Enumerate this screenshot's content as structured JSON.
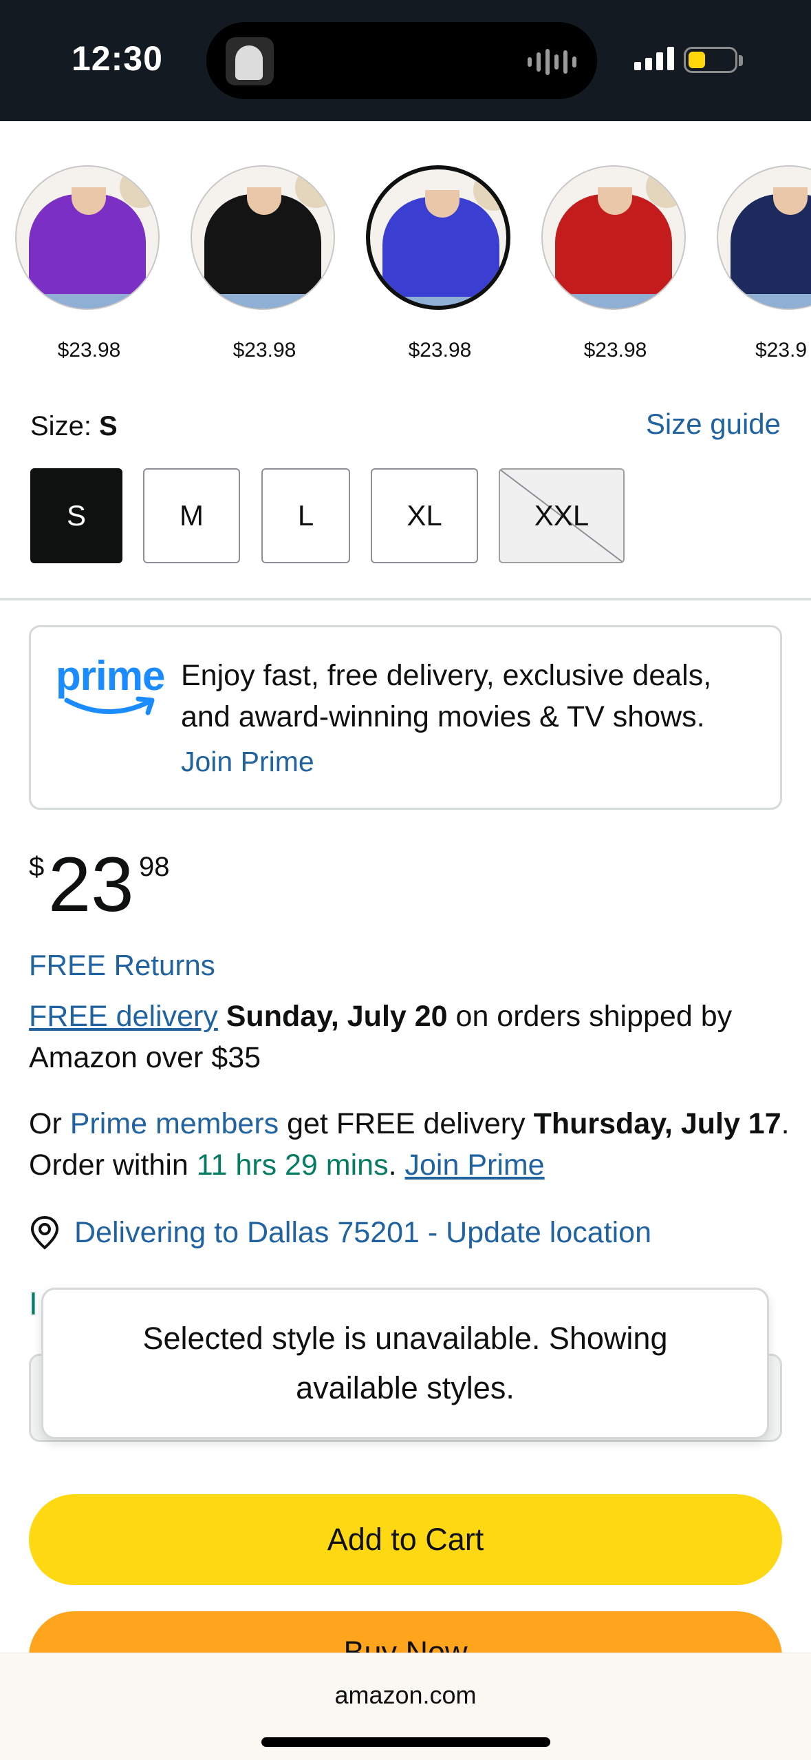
{
  "status_bar": {
    "time": "12:30"
  },
  "swatches": [
    {
      "color": "#7b2fc4",
      "price": "$23.98",
      "selected": false,
      "icon": "purple-shirt"
    },
    {
      "color": "#141414",
      "price": "$23.98",
      "selected": false,
      "icon": "black-shirt"
    },
    {
      "color": "#3b3fd1",
      "price": "$23.98",
      "selected": true,
      "icon": "blue-shirt"
    },
    {
      "color": "#c41c1c",
      "price": "$23.98",
      "selected": false,
      "icon": "red-shirt"
    },
    {
      "color": "#1c2a5e",
      "price": "$23.9",
      "selected": false,
      "icon": "navy-shirt"
    }
  ],
  "size": {
    "label": "Size: ",
    "value": "S",
    "guide_link": "Size guide",
    "options": [
      {
        "label": "S",
        "state": "selected"
      },
      {
        "label": "M",
        "state": "available"
      },
      {
        "label": "L",
        "state": "available"
      },
      {
        "label": "XL",
        "state": "available"
      },
      {
        "label": "XXL",
        "state": "unavailable"
      }
    ]
  },
  "prime_promo": {
    "logo_text": "prime",
    "text": "Enjoy fast, free delivery, exclusive deals, and award-winning movies & TV shows.",
    "join_link": "Join Prime"
  },
  "price": {
    "symbol": "$",
    "whole": "23",
    "fraction": "98"
  },
  "free_returns": "FREE Returns",
  "delivery": {
    "free_delivery_link": "FREE delivery",
    "date": "Sunday, July 20",
    "suffix": " on orders shipped by Amazon over $35"
  },
  "prime_delivery": {
    "prefix": "Or ",
    "members_link": "Prime members",
    "middle": " get FREE delivery ",
    "date": "Thursday, July 17",
    "order_within": ". Order within ",
    "countdown": "11 hrs 29 mins",
    "period": ". ",
    "join_link": "Join Prime"
  },
  "location": {
    "text": "Delivering to Dallas 75201 - Update location",
    "icon": "location-pin-icon"
  },
  "partial_hidden_text": "I",
  "toast": {
    "message": "Selected style is unavailable. Showing available styles."
  },
  "buttons": {
    "add_to_cart": "Add to Cart",
    "buy_now": "Buy Now"
  },
  "browser": {
    "url": "amazon.com"
  },
  "colors": {
    "link": "#2162a1",
    "add_to_cart": "#ffd814",
    "buy_now": "#ffa41c",
    "prime_blue": "#1a8cff",
    "countdown_green": "#067d62"
  }
}
